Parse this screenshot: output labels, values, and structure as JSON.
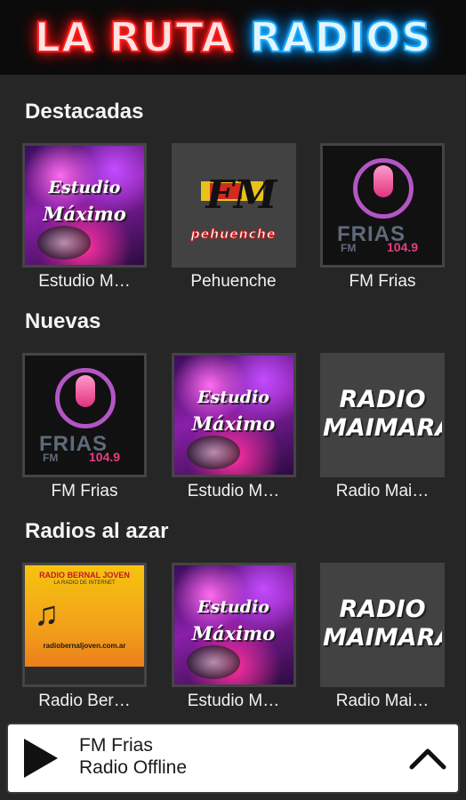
{
  "header": {
    "logo_part1": "LA RUTA",
    "logo_part2": "RADIOS"
  },
  "sections": [
    {
      "title": "Destacadas",
      "items": [
        {
          "label": "Estudio M…",
          "art": "estudio-maximo"
        },
        {
          "label": "Pehuenche",
          "art": "pehuenche"
        },
        {
          "label": "FM Frias",
          "art": "fm-frias"
        }
      ]
    },
    {
      "title": "Nuevas",
      "items": [
        {
          "label": "FM Frias",
          "art": "fm-frias"
        },
        {
          "label": "Estudio M…",
          "art": "estudio-maximo"
        },
        {
          "label": "Radio Mai…",
          "art": "radio-maimara"
        }
      ]
    },
    {
      "title": "Radios al azar",
      "items": [
        {
          "label": "Radio Ber…",
          "art": "radio-bernal"
        },
        {
          "label": "Estudio M…",
          "art": "estudio-maximo"
        },
        {
          "label": "Radio Mai…",
          "art": "radio-maimara"
        }
      ]
    }
  ],
  "art_text": {
    "estudio_line1": "Estudio",
    "estudio_line2": "Máximo",
    "pehuenche_fm": "FM",
    "pehuenche_word": "pehuenche",
    "frias_word": "FRIAS",
    "frias_fm": "FM",
    "frias_freq": "104.9",
    "maimara_line1": "RADIO",
    "maimara_line2": "MAIMARÁ",
    "bernal_title": "RADIO BERNAL JOVEN",
    "bernal_sub": "LA RADIO DE INTERNET",
    "bernal_web": "radiobernaljoven.com.ar"
  },
  "player": {
    "station": "FM Frias",
    "status": "Radio Offline",
    "play_icon": "play-icon",
    "expand_icon": "chevron-up-icon"
  },
  "colors": {
    "background": "#262626",
    "header": "#0b0b0b",
    "logo_red": "#ff1a1a",
    "logo_blue": "#18a8ff",
    "player_bg": "#ffffff"
  }
}
